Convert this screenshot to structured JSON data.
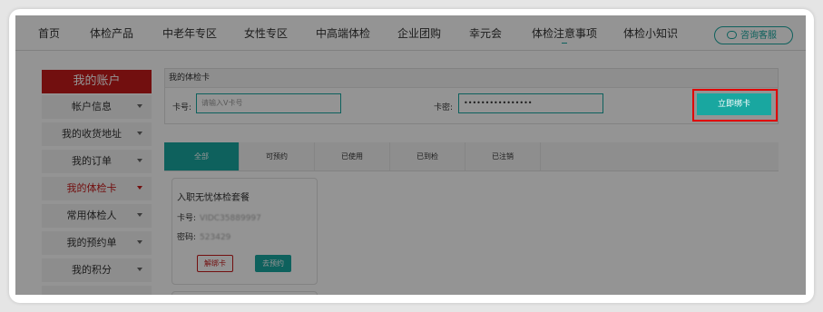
{
  "nav": {
    "items": [
      {
        "label": "首页"
      },
      {
        "label": "体检产品"
      },
      {
        "label": "中老年专区"
      },
      {
        "label": "女性专区"
      },
      {
        "label": "中高端体检"
      },
      {
        "label": "企业团购"
      },
      {
        "label": "幸元会"
      },
      {
        "label": "体检注意事项",
        "active": true
      },
      {
        "label": "体检小知识"
      }
    ],
    "consult_label": "咨询客服"
  },
  "sidebar": {
    "title": "我的账户",
    "items": [
      {
        "label": "帐户信息"
      },
      {
        "label": "我的收货地址"
      },
      {
        "label": "我的订单"
      },
      {
        "label": "我的体检卡",
        "active": true
      },
      {
        "label": "常用体检人"
      },
      {
        "label": "我的预约单"
      },
      {
        "label": "我的积分"
      }
    ]
  },
  "bind_card": {
    "title": "我的体检卡",
    "card_no_label": "卡号:",
    "card_no_placeholder": "请输入V卡号",
    "password_label": "卡密:",
    "password_value": "••••••••••••••••",
    "submit_label": "立即绑卡"
  },
  "tabs": [
    {
      "label": "全部",
      "active": true
    },
    {
      "label": "可预约"
    },
    {
      "label": "已使用"
    },
    {
      "label": "已到检"
    },
    {
      "label": "已注销"
    }
  ],
  "card": {
    "title": "入职无忧体检套餐",
    "card_no_label": "卡号:",
    "card_no_value": "VIDC35889997",
    "password_label": "密码:",
    "password_value": "523429",
    "unbind_label": "解绑卡",
    "book_label": "去预约"
  },
  "colors": {
    "accent": "#19a7a0",
    "brand_red": "#c51a1a",
    "highlight": "#e00000"
  }
}
